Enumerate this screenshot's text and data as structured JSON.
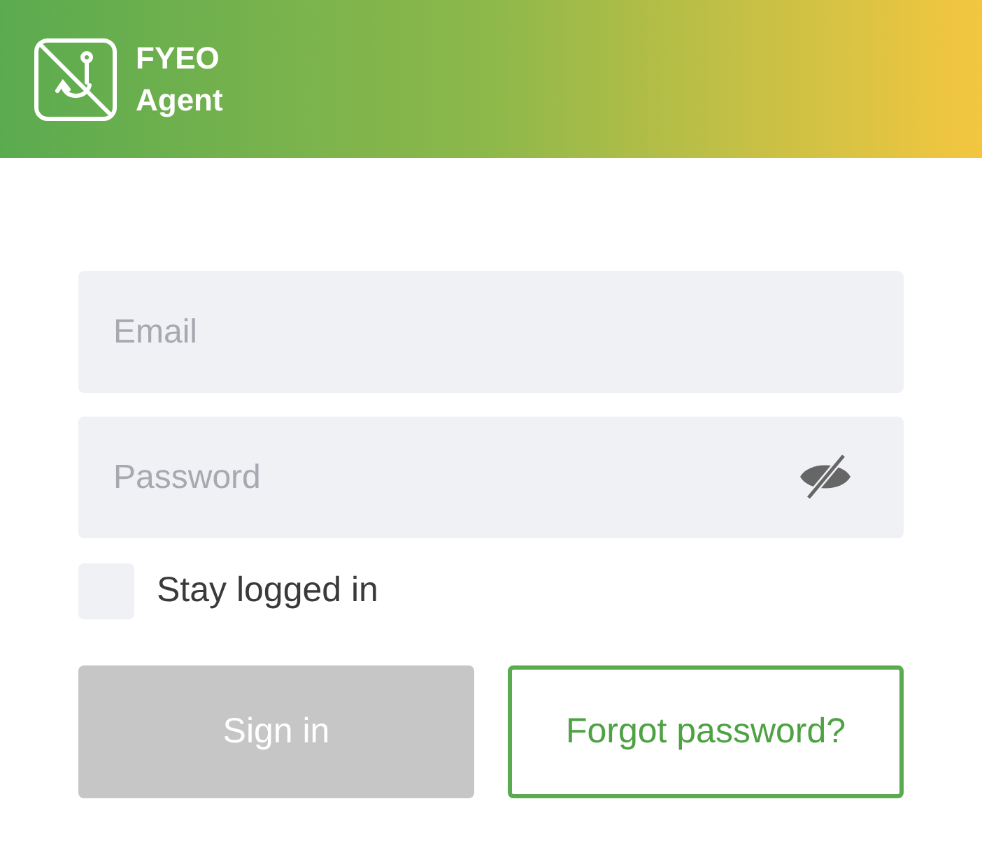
{
  "header": {
    "brand_line_1": "FYEO",
    "brand_line_2": "Agent"
  },
  "email": {
    "placeholder": "Email"
  },
  "password": {
    "placeholder": "Password"
  },
  "stay_logged_in": {
    "label": "Stay logged in",
    "checked": false
  },
  "sign_in": {
    "label": "Sign in",
    "disabled": true
  },
  "forgot_password": {
    "label": "Forgot password?"
  }
}
